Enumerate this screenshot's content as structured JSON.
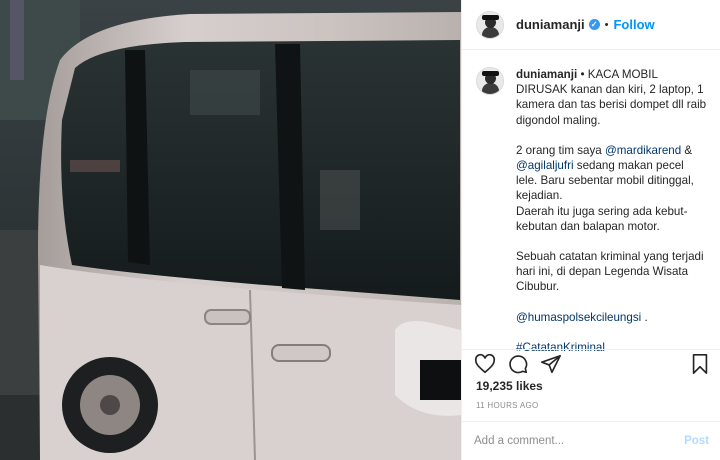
{
  "post": {
    "username": "duniamanji",
    "verified_icon": "verified-badge-icon",
    "separator": "•",
    "follow_label": "Follow"
  },
  "caption": {
    "username": "duniamanji",
    "paragraphs": [
      "• KACA MOBIL DIRUSAK kanan dan kiri, 2 laptop, 1 kamera dan tas berisi dompet dll raib digondol maling."
    ],
    "p2_a": "2 orang tim saya",
    "p2_mention1": "@mardikarend",
    "p2_b": "&",
    "p2_mention2": "@agilaljufri",
    "p2_c": "sedang makan pecel lele. Baru sebentar mobil ditinggal, kejadian.",
    "p3": "Daerah itu juga sering ada kebut-kebutan dan balapan motor.",
    "p4": "Sebuah catatan kriminal yang terjadi hari ini, di depan Legenda Wisata Cibubur.",
    "mention3": "@humaspolsekcileungsi",
    "mention3_suffix": ".",
    "hashtag": "#CatatanKriminal"
  },
  "engagement": {
    "likes": "19,235 likes",
    "time_ago": "11 HOURS AGO"
  },
  "comment": {
    "placeholder": "Add a comment...",
    "post_label": "Post"
  },
  "colors": {
    "accent": "#0095f6",
    "post_disabled": "#b3dbff",
    "mention": "#00376b"
  }
}
